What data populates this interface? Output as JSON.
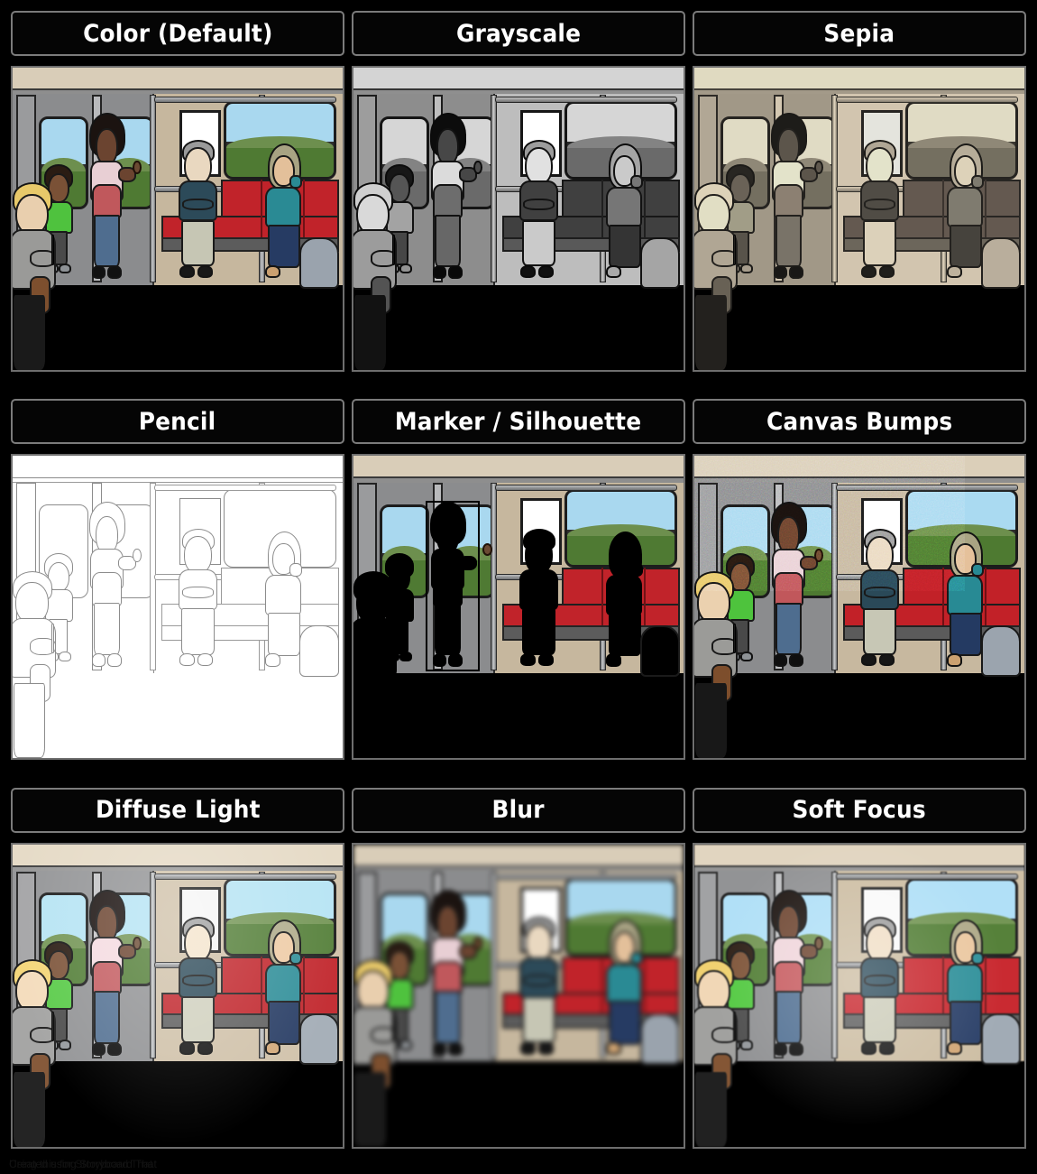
{
  "page": {
    "background_color": "#000000",
    "grid_rows": 3,
    "grid_columns": 3
  },
  "panels": [
    {
      "id": "color-default",
      "label": "Color (Default)",
      "style": "color",
      "row": 1,
      "col": 1
    },
    {
      "id": "grayscale",
      "label": "Grayscale",
      "style": "grayscale",
      "row": 1,
      "col": 2
    },
    {
      "id": "sepia",
      "label": "Sepia",
      "style": "sepia",
      "row": 1,
      "col": 3
    },
    {
      "id": "pencil",
      "label": "Pencil",
      "style": "pencil",
      "row": 2,
      "col": 1
    },
    {
      "id": "marker-silhouette",
      "label": "Marker / Silhouette",
      "style": "silhouette",
      "row": 2,
      "col": 2
    },
    {
      "id": "canvas-bumps",
      "label": "Canvas Bumps",
      "style": "canvas",
      "row": 2,
      "col": 3
    },
    {
      "id": "diffuse-light",
      "label": "Diffuse Light",
      "style": "diffuse",
      "row": 3,
      "col": 1
    },
    {
      "id": "blur",
      "label": "Blur",
      "style": "blur",
      "row": 3,
      "col": 2
    },
    {
      "id": "soft-focus",
      "label": "Soft Focus",
      "style": "soft",
      "row": 3,
      "col": 3
    }
  ],
  "header_style": {
    "text_color": "#ffffff",
    "background_color": "#050505",
    "border_color": "#7b7b7b"
  },
  "scene": {
    "setting": "subway train car interior",
    "characters": [
      {
        "name": "blond-man-with-satchel",
        "position": "far-left-foreground",
        "holding": "phone"
      },
      {
        "name": "boy-in-green-shirt",
        "position": "left",
        "holding": "cup"
      },
      {
        "name": "woman-with-afro",
        "position": "left-center-standing",
        "holding": "spoon"
      },
      {
        "name": "seated-man-with-glasses",
        "position": "center-seated",
        "holding": "phone"
      },
      {
        "name": "woman-in-hijab",
        "position": "right-seated",
        "holding": "phone"
      }
    ],
    "objects": [
      "red bench seats",
      "backpack",
      "white poster",
      "grab poles",
      "windows with green hills"
    ],
    "colors": {
      "ceiling": "#d9cdb8",
      "wall_left": "#8b8c8e",
      "wall_right": "#c6b79e",
      "floor": "#3d3d3d",
      "seat_red": "#c1232a",
      "sky": "#a9d8ef",
      "grass": "#4f7a33"
    }
  },
  "footer": {
    "line1": "Created using Storyboard That",
    "line2": "Using this for Storyboard That"
  }
}
